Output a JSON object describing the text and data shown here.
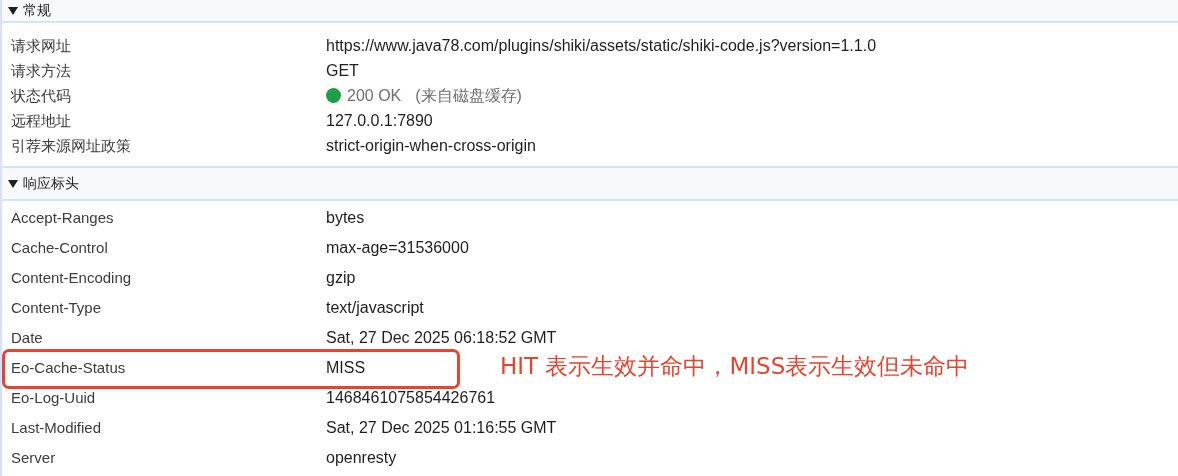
{
  "sections": [
    {
      "title": "常规",
      "expanded": true,
      "rows": [
        {
          "kind": "text",
          "name": "请求网址",
          "value": "https://www.java78.com/plugins/shiki/assets/static/shiki-code.js?version=1.1.0",
          "highlighted": false
        },
        {
          "kind": "text",
          "name": "请求方法",
          "value": "GET",
          "highlighted": false
        },
        {
          "kind": "status",
          "name": "状态代码",
          "value": "200 OK",
          "note": "(来自磁盘缓存)",
          "color": "#1e9e47",
          "highlighted": false
        },
        {
          "kind": "text",
          "name": "远程地址",
          "value": "127.0.0.1:7890",
          "highlighted": false
        },
        {
          "kind": "text",
          "name": "引荐来源网址政策",
          "value": "strict-origin-when-cross-origin",
          "highlighted": false
        }
      ]
    },
    {
      "title": "响应标头",
      "expanded": true,
      "rows": [
        {
          "kind": "text",
          "name": "Accept-Ranges",
          "value": "bytes",
          "highlighted": false
        },
        {
          "kind": "text",
          "name": "Cache-Control",
          "value": "max-age=31536000",
          "highlighted": false
        },
        {
          "kind": "text",
          "name": "Content-Encoding",
          "value": "gzip",
          "highlighted": false
        },
        {
          "kind": "text",
          "name": "Content-Type",
          "value": "text/javascript",
          "highlighted": false
        },
        {
          "kind": "text",
          "name": "Date",
          "value": "Sat, 27 Dec 2025 06:18:52 GMT",
          "highlighted": false
        },
        {
          "kind": "text",
          "name": "Eo-Cache-Status",
          "value": "MISS",
          "highlighted": true
        },
        {
          "kind": "text",
          "name": "Eo-Log-Uuid",
          "value": "1468461075854426761",
          "highlighted": false
        },
        {
          "kind": "text",
          "name": "Last-Modified",
          "value": "Sat, 27 Dec 2025 01:16:55 GMT",
          "highlighted": false
        },
        {
          "kind": "text",
          "name": "Server",
          "value": "openresty",
          "highlighted": false
        }
      ]
    }
  ],
  "annotation": {
    "text": "HIT 表示生效并命中，MISS表示生效但未命中"
  }
}
